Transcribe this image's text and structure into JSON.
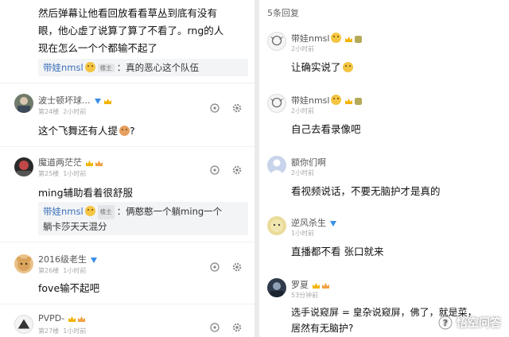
{
  "left": {
    "top_text": [
      "然后弹幕让他看回放看看草丛到底有没有",
      "眼，他心虚了说算了算了不看了。rng的人",
      "现在怎么一个个都输不起了"
    ],
    "top_reply": {
      "name": "带娃nmsl",
      "tag": "楼主",
      "text": "：真的恶心这个队伍"
    },
    "comments": [
      {
        "user": "波士顿坏球...",
        "floor": "第24楼",
        "time": "2小时前",
        "text": "这个飞舞还有人提",
        "after_emoji": "?"
      },
      {
        "user": "魔道两茫茫",
        "floor": "第25楼",
        "time": "1小时前",
        "text": "ming辅助看着很舒服",
        "reply": {
          "name": "带娃nmsl",
          "tag": "楼主",
          "line1": "：俩憨憨一个躺ming一个",
          "line2": "躺卡莎天天混分"
        }
      },
      {
        "user": "2016级老生",
        "floor": "第26楼",
        "time": "1小时前",
        "text": "fove输不起吧"
      },
      {
        "user": "PVPD-",
        "floor": "第27楼",
        "time": "1小时前",
        "text": ""
      }
    ]
  },
  "right": {
    "header": "5条回复",
    "replies": [
      {
        "user": "带娃nmsl",
        "time": "2小时前",
        "text": "让确实说了"
      },
      {
        "user": "带娃nmsl",
        "time": "2小时前",
        "text": "自己去看录像吧"
      },
      {
        "user": "额你们啊",
        "time": "2小时前",
        "text": "看视频说话，不要无脑护才是真的"
      },
      {
        "user": "逆风杀生",
        "time": "1小时前",
        "text": "直播都不看 张口就来"
      },
      {
        "user": "罗夏",
        "time": "53分钟前",
        "text": "选手说窥屏 = 皇杂说窥屏，佛了，就是菜，",
        "text2": "居然有无脑护?"
      }
    ]
  },
  "watermark": "悟空问答",
  "colors": {
    "reply_name": "#3b6fb6",
    "badge_v": "#3a8ee6",
    "badge_crown": "#f2b400"
  },
  "icons": [
    "share-icon",
    "gear-icon",
    "verified-badge-icon",
    "crown-badge-icon"
  ]
}
